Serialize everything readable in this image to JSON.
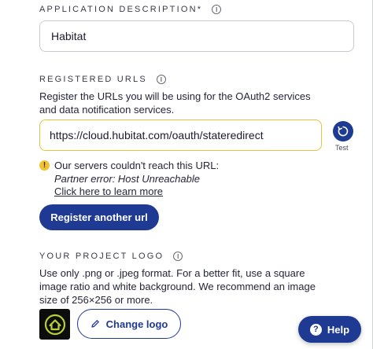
{
  "app_description": {
    "label": "APPLICATION DESCRIPTION",
    "required_mark": "*",
    "value": "Habitat"
  },
  "registered_urls": {
    "label": "REGISTERED URLS",
    "description_line1": "Register the URLs you will be using for the OAuth2 services",
    "description_line2": "and data notification services.",
    "url_value": "https://cloud.hubitat.com/oauth/stateredirect",
    "test_label": "Test",
    "warning_title": "Our servers couldn't reach this URL:",
    "warning_detail": "Partner error: Host Unreachable",
    "learn_more": "Click here to learn more",
    "register_another": "Register another url"
  },
  "project_logo": {
    "label": "YOUR PROJECT LOGO",
    "description_line1": "Use only .png or .jpeg format. For a better fit, use a square",
    "description_line2": "image ratio and white background. We recommend an image",
    "description_line3": "size of 256×256 or more.",
    "change_logo": "Change logo"
  },
  "help": {
    "label": "Help"
  },
  "colors": {
    "primary": "#1f3a93",
    "warning": "#f2c230",
    "logo_accent": "#b6d134"
  },
  "icons": {
    "info": "info-circle-icon",
    "test": "refresh-icon",
    "warning": "warning-icon",
    "edit": "pencil-icon",
    "help": "question-icon",
    "logo": "house-logo-icon"
  }
}
